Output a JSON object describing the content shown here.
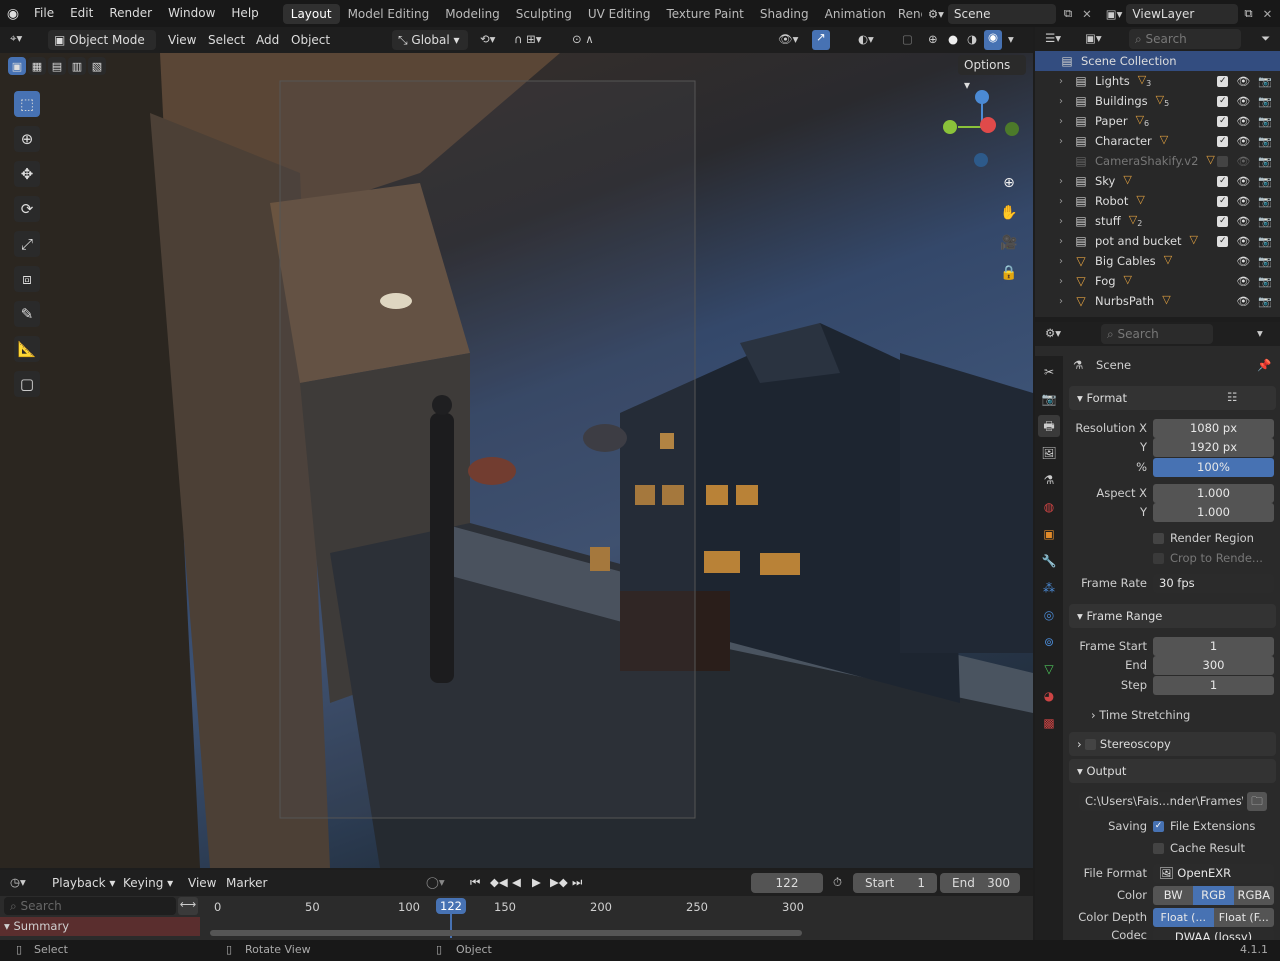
{
  "menus": [
    "File",
    "Edit",
    "Render",
    "Window",
    "Help"
  ],
  "workspaces": [
    "Layout",
    "Model Editing",
    "Modeling",
    "Sculpting",
    "UV Editing",
    "Texture Paint",
    "Shading",
    "Animation",
    "Rend"
  ],
  "scene_name": "Scene",
  "view_layer": "ViewLayer",
  "viewport_header": {
    "mode": "Object Mode",
    "items": [
      "View",
      "Select",
      "Add",
      "Object"
    ],
    "orientation": "Global",
    "options": "Options"
  },
  "outliner": {
    "search_placeholder": "Search",
    "root": "Scene Collection",
    "items": [
      {
        "label": "Lights",
        "sub": "3"
      },
      {
        "label": "Buildings",
        "sub": "5"
      },
      {
        "label": "Paper",
        "sub": "6"
      },
      {
        "label": "Character",
        "sub": ""
      },
      {
        "label": "CameraShakify.v2",
        "sub": ""
      },
      {
        "label": "Sky",
        "sub": ""
      },
      {
        "label": "Robot",
        "sub": ""
      },
      {
        "label": "stuff",
        "sub": "2"
      },
      {
        "label": "pot and bucket",
        "sub": ""
      },
      {
        "label": "Big Cables",
        "sub": ""
      },
      {
        "label": "Fog",
        "sub": ""
      },
      {
        "label": "NurbsPath",
        "sub": ""
      }
    ]
  },
  "properties": {
    "search_placeholder": "Search",
    "context": "Scene",
    "format": {
      "title": "Format",
      "resolution_x_label": "Resolution X",
      "resolution_x": "1080 px",
      "y_label": "Y",
      "resolution_y": "1920 px",
      "pct_label": "%",
      "percent": "100%",
      "aspect_x_label": "Aspect X",
      "aspect_x": "1.000",
      "aspect_y": "1.000",
      "render_region": "Render Region",
      "crop": "Crop to Rende...",
      "frame_rate_label": "Frame Rate",
      "frame_rate": "30 fps"
    },
    "frame_range": {
      "title": "Frame Range",
      "start_label": "Frame Start",
      "start": "1",
      "end_label": "End",
      "end": "300",
      "step_label": "Step",
      "step": "1",
      "time_stretching": "Time Stretching"
    },
    "stereoscopy": "Stereoscopy",
    "output": {
      "title": "Output",
      "path": "C:\\Users\\Fais...nder\\Frames\\",
      "saving_label": "Saving",
      "file_ext": "File Extensions",
      "cache": "Cache Result",
      "file_format_label": "File Format",
      "file_format": "OpenEXR",
      "color_label": "Color",
      "color_opts": [
        "BW",
        "RGB",
        "RGBA"
      ],
      "depth_label": "Color Depth",
      "depth_opts": [
        "Float (...",
        "Float (F..."
      ],
      "codec_label": "Codec",
      "codec": "DWAA (lossy)"
    }
  },
  "timeline": {
    "menus": [
      "Playback",
      "Keying",
      "View",
      "Marker"
    ],
    "current": "122",
    "start_label": "Start",
    "start": "1",
    "end_label": "End",
    "end": "300",
    "ticks": [
      "0",
      "50",
      "100",
      "122",
      "150",
      "200",
      "250",
      "300"
    ],
    "search_placeholder": "Search",
    "summary": "Summary"
  },
  "status": {
    "select": "Select",
    "rotate": "Rotate View",
    "object": "Object",
    "version": "4.1.1"
  }
}
